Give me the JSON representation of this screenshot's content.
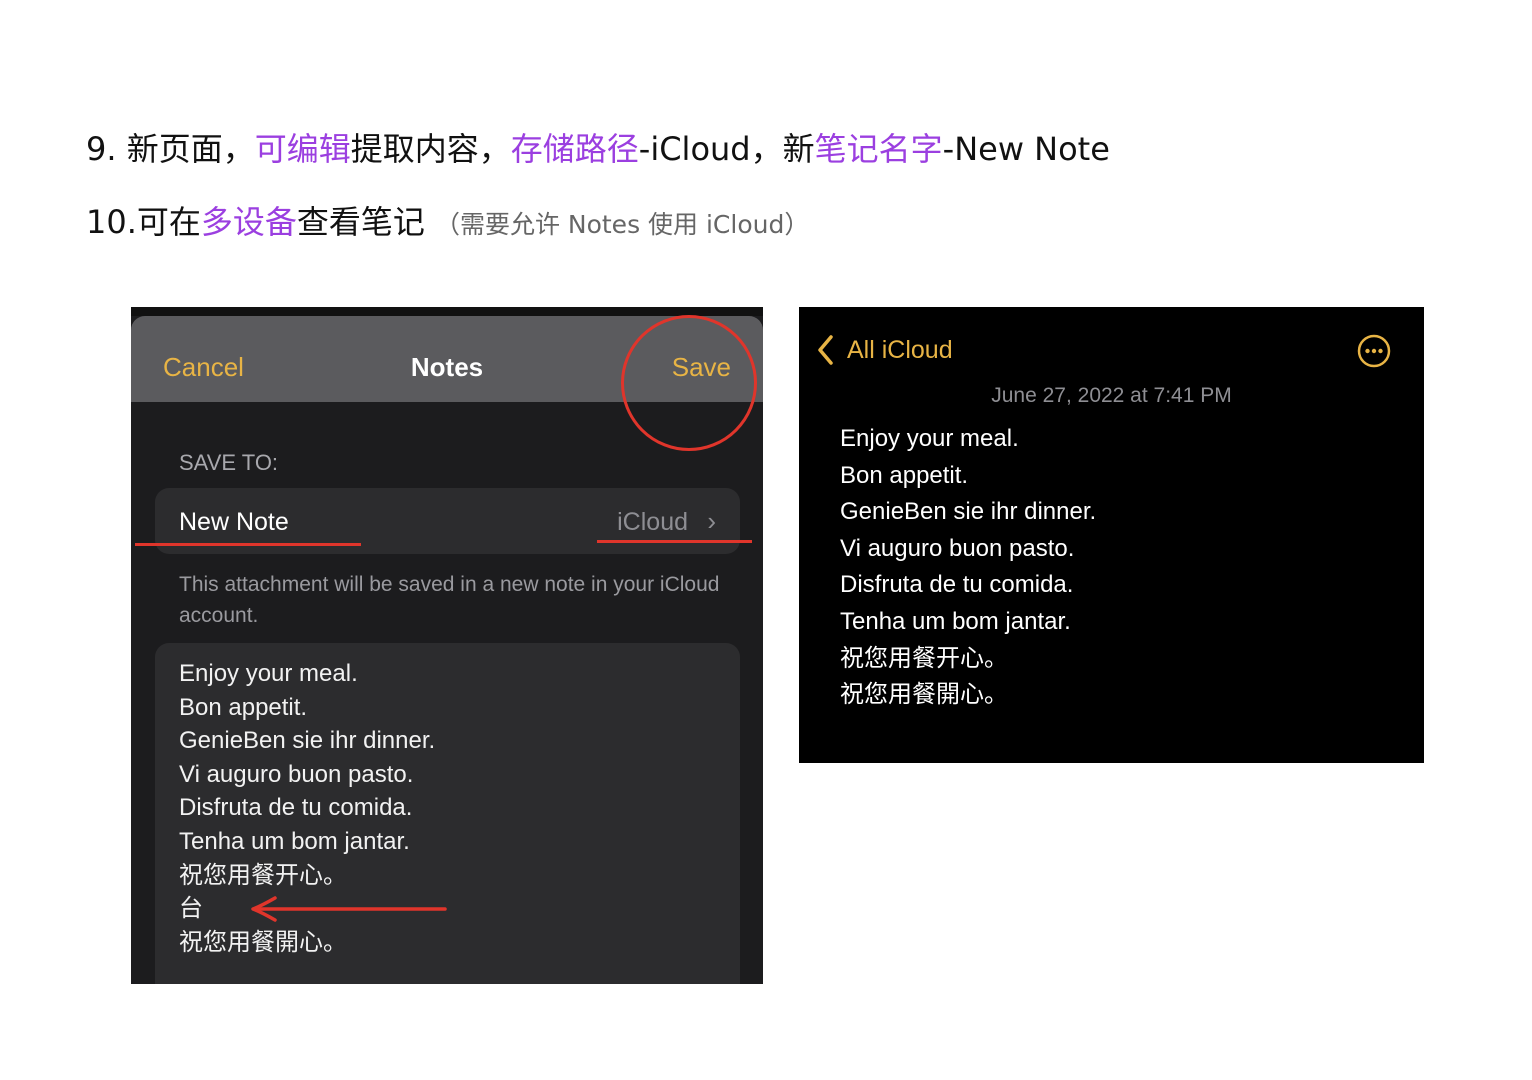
{
  "instructions": {
    "line1": {
      "prefix": "9. 新页面，",
      "hl1": "可编辑",
      "t1": "提取内容，",
      "hl2": "存储路径",
      "t2": "-iCloud，新",
      "hl3": "笔记名字",
      "t3": "-New Note"
    },
    "line2": {
      "prefix": "10.可在",
      "hl1": "多设备",
      "t1": "查看笔记",
      "note": "（需要允许 Notes 使用 iCloud）"
    },
    "highlight_color": "#9b3fe0"
  },
  "save_sheet": {
    "cancel_label": "Cancel",
    "title": "Notes",
    "save_label": "Save",
    "section_label": "SAVE TO:",
    "note_name": "New Note",
    "destination": "iCloud",
    "chevron": "›",
    "footnote": "This attachment will be saved in a new note in your iCloud account.",
    "content_lines": [
      "Enjoy your meal.",
      "Bon appetit.",
      "GenieBen sie ihr dinner.",
      "Vi auguro buon pasto.",
      "Disfruta de tu comida.",
      "Tenha um bom jantar.",
      "祝您用餐开心。",
      "台",
      "祝您用餐開心。"
    ],
    "accent_color": "#e8b445",
    "annotation_color": "#e0352b"
  },
  "note_view": {
    "back_label": "All iCloud",
    "date": "June 27, 2022 at 7:41 PM",
    "lines": [
      "Enjoy your meal.",
      "Bon appetit.",
      "GenieBen sie ihr dinner.",
      "Vi auguro buon pasto.",
      "Disfruta de tu comida.",
      "Tenha um bom jantar.",
      "祝您用餐开心。",
      "祝您用餐開心。"
    ]
  }
}
